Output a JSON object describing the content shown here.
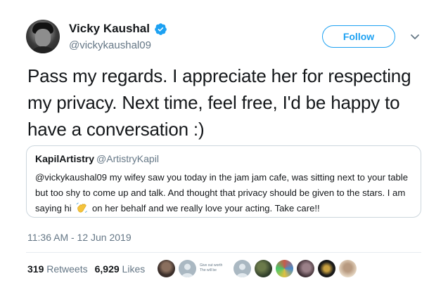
{
  "author": {
    "name": "Vicky Kaushal",
    "handle": "@vickykaushal09",
    "verified_icon": "verified-badge-icon",
    "accent_color": "#1da1f2"
  },
  "actions": {
    "follow_label": "Follow",
    "more_icon": "chevron-down-icon"
  },
  "tweet": {
    "text": "Pass my regards. I appreciate her for respecting my privacy. Next time, feel free, I'd be happy to have a conversation :)"
  },
  "quoted": {
    "name": "KapilArtistry",
    "handle": "@ArtistryKapil",
    "text_before_emoji": "@vickykaushal09 my wifey saw you today in the jam jam cafe, was sitting next to your table but too shy to come up and talk. And thought that privacy should be given to the stars. I am saying hi",
    "emoji_icon": "waving-hand-emoji",
    "text_after_emoji": "on her behalf and we really love your acting. Take care!!"
  },
  "meta": {
    "timestamp": "11:36 AM - 12 Jun 2019"
  },
  "stats": {
    "retweets_count": "319",
    "retweets_label": "Retweets",
    "likes_count": "6,929",
    "likes_label": "Likes"
  },
  "likers": {
    "text_avatar_line1": "Give out worth",
    "text_avatar_line2": "The will be",
    "colors": [
      "#3a2e2a",
      "#aab8c2",
      "#aab8c2",
      "#2f3d2a",
      "#c85a4a",
      "#3f2f35",
      "#1a1a1a",
      "#e6d7c3"
    ]
  }
}
